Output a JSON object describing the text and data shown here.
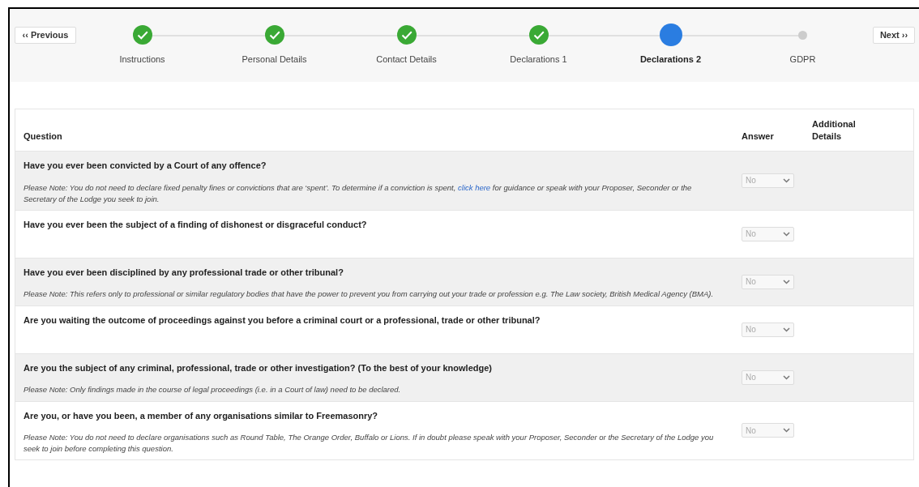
{
  "nav": {
    "previous": "‹‹ Previous",
    "next": "Next ››"
  },
  "steps": [
    {
      "label": "Instructions",
      "kind": "done"
    },
    {
      "label": "Personal Details",
      "kind": "done"
    },
    {
      "label": "Contact Details",
      "kind": "done"
    },
    {
      "label": "Declarations 1",
      "kind": "done"
    },
    {
      "label": "Declarations 2",
      "kind": "current"
    },
    {
      "label": "GDPR",
      "kind": "pending"
    }
  ],
  "table": {
    "columns": [
      "Question",
      "Answer",
      "Additional Details"
    ],
    "rows": [
      {
        "question": "Have you ever been convicted by a Court of any offence?",
        "note": [
          {
            "kind": "text",
            "text": "Please Note: You do not need to declare fixed penalty fines or convictions that are ‘spent’. To determine if a conviction is spent, "
          },
          {
            "kind": "link",
            "text": "click here"
          },
          {
            "kind": "text",
            "text": " for guidance or speak with your Proposer, Seconder or the Secretary of the Lodge you seek to join."
          }
        ],
        "answer": "No",
        "disabled": true
      },
      {
        "question": "Have you ever been the subject of a finding of dishonest or disgraceful conduct?",
        "answer": "No",
        "disabled": true
      },
      {
        "question": "Have you ever been disciplined by any professional trade or other tribunal?",
        "note": [
          {
            "kind": "text",
            "text": "Please Note: This refers only to professional or similar regulatory bodies that have the power to prevent you from carrying out your trade or profession e.g. The Law society, British Medical Agency (BMA)."
          }
        ],
        "answer": "No",
        "disabled": true
      },
      {
        "question": "Are you waiting the outcome of proceedings against you before a criminal court or a professional, trade or other tribunal?",
        "answer": "No",
        "disabled": true
      },
      {
        "question": "Are you the subject of any criminal, professional, trade or other investigation? (To the best of your knowledge)",
        "note": [
          {
            "kind": "text",
            "text": "Please Note: Only findings made in the course of legal proceedings (i.e. in a Court of law) need to be declared."
          }
        ],
        "answer": "No",
        "disabled": true
      },
      {
        "question": "Are you, or have you been, a member of any organisations similar to Freemasonry?",
        "note": [
          {
            "kind": "text",
            "text": "Please Note: You do not need to declare organisations such as Round Table, The Orange Order, Buffalo or Lions. If in doubt please speak with your Proposer, Seconder or the Secretary of the Lodge you seek to join before completing this question."
          }
        ],
        "answer": "No",
        "disabled": true
      }
    ]
  }
}
